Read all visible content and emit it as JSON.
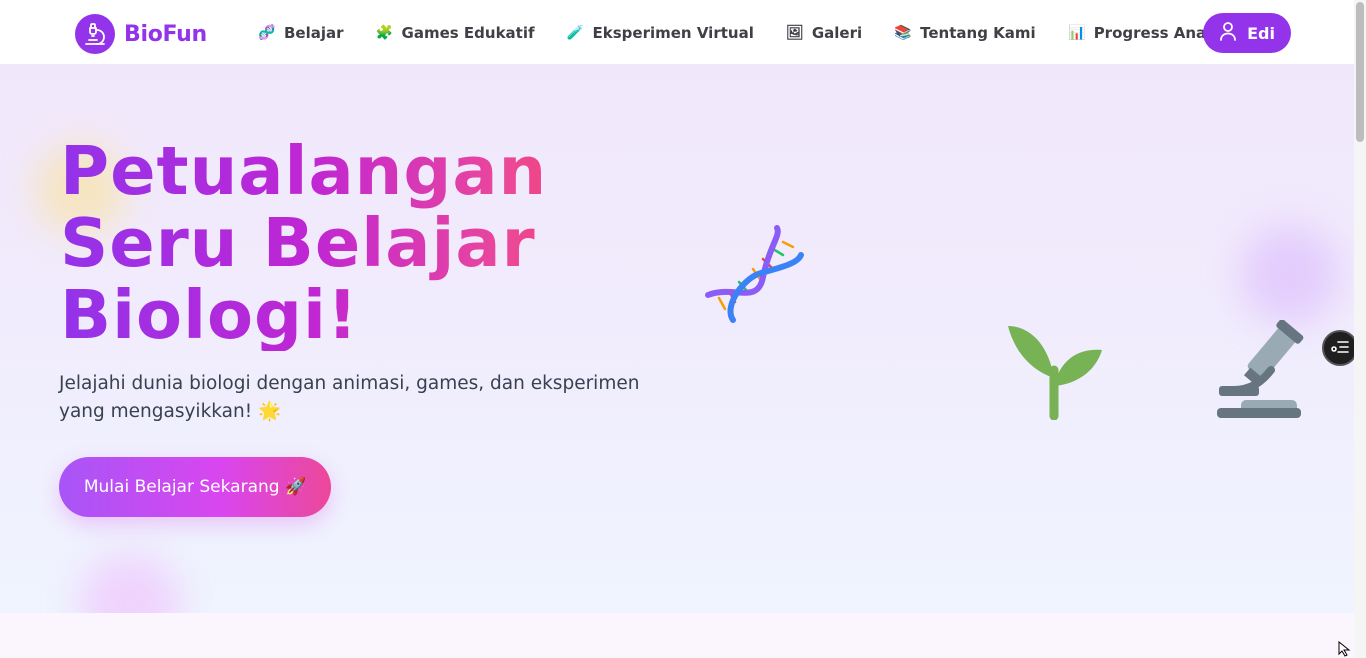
{
  "brand": {
    "name": "BioFun",
    "logo_icon": "microscope-icon",
    "color": "#9333ea"
  },
  "nav": {
    "items": [
      {
        "label": "Belajar",
        "icon": "dna-icon"
      },
      {
        "label": "Games Edukatif",
        "icon": "puzzle-icon"
      },
      {
        "label": "Eksperimen Virtual",
        "icon": "test-tube-icon"
      },
      {
        "label": "Galeri",
        "icon": "picture-icon"
      },
      {
        "label": "Tentang Kami",
        "icon": "books-icon"
      },
      {
        "label": "Progress Anak",
        "icon": "bar-chart-icon"
      }
    ],
    "user": {
      "name": "Edi",
      "icon": "user-icon"
    }
  },
  "hero": {
    "title": "Petualangan Seru Belajar Biologi!",
    "subtitle": "Jelajahi dunia biologi dengan animasi, games, dan eksperimen yang mengasyikkan! 🌟",
    "cta_label": "Mulai Belajar Sekarang 🚀",
    "illustrations": [
      "dna-icon",
      "sprout-icon",
      "microscope-icon"
    ]
  },
  "colors": {
    "accent": "#9333ea",
    "gradient_start": "#a855f7",
    "gradient_end": "#ec4899"
  }
}
